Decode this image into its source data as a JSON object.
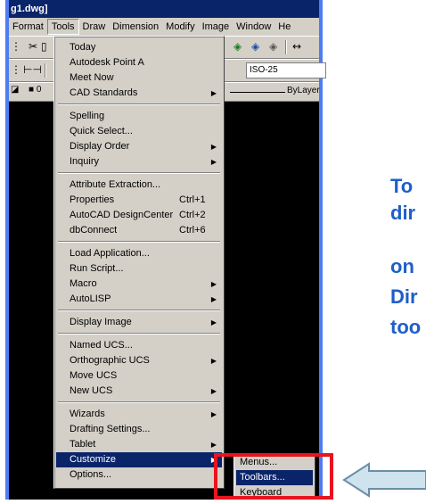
{
  "window": {
    "title": "g1.dwg]"
  },
  "menubar": {
    "items": [
      "Format",
      "Tools",
      "Draw",
      "Dimension",
      "Modify",
      "Image",
      "Window",
      "He"
    ]
  },
  "toolbar": {
    "dimstyle_value": "ISO-25",
    "layer_value": "0",
    "lineweight_value": "ByLayer"
  },
  "tools_menu": {
    "groups": [
      [
        {
          "label": "Today"
        },
        {
          "label": "Autodesk Point A"
        },
        {
          "label": "Meet Now"
        },
        {
          "label": "CAD Standards",
          "submenu": true
        }
      ],
      [
        {
          "label": "Spelling"
        },
        {
          "label": "Quick Select..."
        },
        {
          "label": "Display Order",
          "submenu": true
        },
        {
          "label": "Inquiry",
          "submenu": true
        }
      ],
      [
        {
          "label": "Attribute Extraction..."
        },
        {
          "label": "Properties",
          "shortcut": "Ctrl+1"
        },
        {
          "label": "AutoCAD DesignCenter",
          "shortcut": "Ctrl+2"
        },
        {
          "label": "dbConnect",
          "shortcut": "Ctrl+6"
        }
      ],
      [
        {
          "label": "Load Application..."
        },
        {
          "label": "Run Script..."
        },
        {
          "label": "Macro",
          "submenu": true
        },
        {
          "label": "AutoLISP",
          "submenu": true
        }
      ],
      [
        {
          "label": "Display Image",
          "submenu": true
        }
      ],
      [
        {
          "label": "Named UCS..."
        },
        {
          "label": "Orthographic UCS",
          "submenu": true
        },
        {
          "label": "Move UCS"
        },
        {
          "label": "New UCS",
          "submenu": true
        }
      ],
      [
        {
          "label": "Wizards",
          "submenu": true
        },
        {
          "label": "Drafting Settings..."
        },
        {
          "label": "Tablet",
          "submenu": true
        },
        {
          "label": "Customize",
          "submenu": true,
          "highlighted": true
        },
        {
          "label": "Options..."
        }
      ]
    ]
  },
  "customize_submenu": {
    "items": [
      {
        "label": "Menus..."
      },
      {
        "label": "Toolbars...",
        "highlighted": true
      },
      {
        "label": "Keyboard"
      }
    ]
  },
  "slide_text": {
    "line1": "To",
    "line2": "dir",
    "line3": "on",
    "line4": "Dir",
    "line5": "too"
  },
  "colors": {
    "title_bar": "#0a246a",
    "highlight": "#0a246a",
    "frame": "#4f7cf0",
    "callout_box": "#e8141e",
    "slide_text": "#1f5ec8",
    "arrow_fill": "#cfe3ee"
  }
}
